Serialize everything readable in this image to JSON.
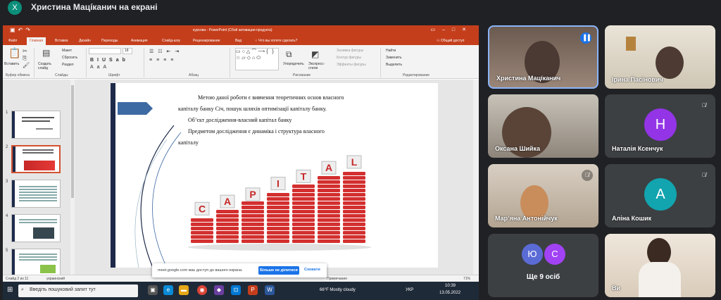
{
  "presenter": {
    "initial": "Х",
    "title": "Христина Мацíканич на екрані"
  },
  "ppt": {
    "window_title": "курсова - PowerPoint (Сбой активации продукта)",
    "tabs": [
      "Файл",
      "Главная",
      "Вставка",
      "Дизайн",
      "Переходы",
      "Анимация",
      "Слайд-шоу",
      "Рецензирование",
      "Вид"
    ],
    "tell_me": "Что вы хотите сделать?",
    "share": "Общий доступ",
    "groups": {
      "clipboard": "Буфер обмена",
      "slides": "Слайды",
      "font": "Шрифт",
      "paragraph": "Абзац",
      "drawing": "Рисование",
      "editing": "Редактирование"
    },
    "ribbon_labels": {
      "paste": "Вставить",
      "new_slide": "Создать слайд",
      "layout": "Макет",
      "reset": "Сбросить",
      "section": "Раздел",
      "font_size": "18",
      "arrange": "Упорядочить",
      "quick_styles": "Экспресс-стили",
      "fill": "Заливка фигуры",
      "outline": "Контур фигуры",
      "effects": "Эффекты фигуры",
      "find": "Найти",
      "replace": "Заменить",
      "select": "Выделить"
    },
    "thumb_numbers": [
      "1",
      "2",
      "3",
      "4",
      "5",
      "6"
    ],
    "slide": {
      "line1": "Метою даної роботи є вивчення теоретичних основ власного",
      "line2": "капіталу банку Січ, пошук шляхів оптимізації капіталу банку.",
      "line3": "Об’єкт дослідження-власний капітал банку",
      "line4": "Предметом дослідження є динаміка і структура власного",
      "line5": "капіталу"
    },
    "capital_letters": [
      "C",
      "A",
      "P",
      "I",
      "T",
      "A",
      "L"
    ],
    "capital_levels": [
      0.35,
      0.45,
      0.55,
      0.7,
      0.8,
      0.92,
      1.0
    ],
    "status": {
      "slide": "Слайд 2 из 11",
      "lang": "украинский",
      "notes": "Примечания",
      "zoom": "71%"
    }
  },
  "taskbar": {
    "search": "Введіть пошуковий запит тут",
    "weather": "66°F  Mostly cloudy",
    "lang": "УКР",
    "time": "10:39",
    "date": "13.05.2022"
  },
  "toast": {
    "text": "meet.google.com має доступ до вашого екрана.",
    "stop": "Більше не ділитися",
    "hide": "Сховати"
  },
  "participants": [
    {
      "name": "Христина Мацíканич",
      "speaking": true
    },
    {
      "name": "Ірина Пасінович"
    },
    {
      "name": "Оксана Шийка"
    },
    {
      "name": "Наталія Ксенчук",
      "initial": "Н",
      "color": "#9334e6"
    },
    {
      "name": "Мар’яна Антонійчук"
    },
    {
      "name": "Аліна Кошик",
      "initial": "А",
      "color": "#12a4af"
    },
    {
      "name": "Ще 9 осіб",
      "initials": [
        "Ю",
        "С"
      ],
      "colors": [
        "#5b6bd6",
        "#a142f4"
      ]
    },
    {
      "name": "Ви"
    }
  ]
}
